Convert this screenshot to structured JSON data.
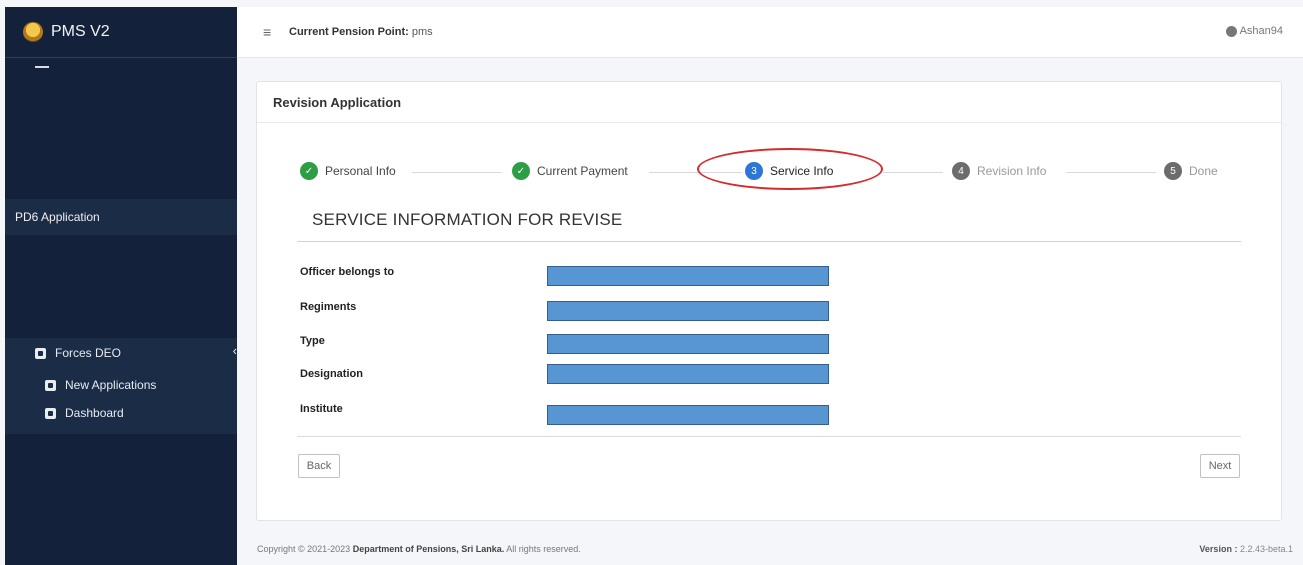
{
  "sidebar": {
    "brand": "PMS V2",
    "pd6": "PD6 Application",
    "menu": [
      {
        "label": "Forces DEO"
      },
      {
        "label": "New Applications"
      },
      {
        "label": "Dashboard"
      }
    ]
  },
  "topbar": {
    "pension_label": "Current Pension Point:",
    "pension_value": "pms",
    "user": "Ashan94"
  },
  "card": {
    "title": "Revision Application",
    "steps": [
      {
        "label": "Personal Info",
        "state": "done",
        "num": ""
      },
      {
        "label": "Current Payment",
        "state": "done",
        "num": ""
      },
      {
        "label": "Service Info",
        "state": "active",
        "num": "3"
      },
      {
        "label": "Revision Info",
        "state": "pending",
        "num": "4"
      },
      {
        "label": "Done",
        "state": "pending",
        "num": "5"
      }
    ],
    "section_title": "SERVICE INFORMATION FOR REVISE",
    "fields": [
      {
        "label": "Officer belongs to"
      },
      {
        "label": "Regiments"
      },
      {
        "label": "Type"
      },
      {
        "label": "Designation"
      },
      {
        "label": "Institute"
      }
    ],
    "back": "Back",
    "next": "Next"
  },
  "footer": {
    "prefix": "Copyright © 2021-2023",
    "org": "Department of Pensions, Sri Lanka.",
    "suffix": "All rights reserved.",
    "version_label": "Version :",
    "version": "2.2.43-beta.1"
  }
}
